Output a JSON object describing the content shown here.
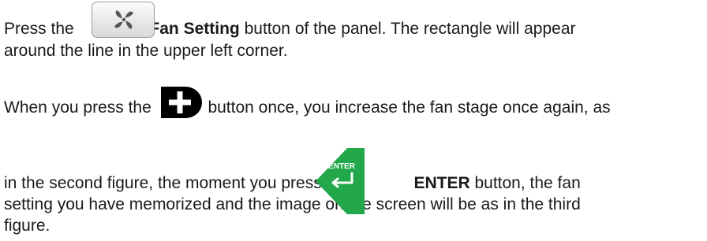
{
  "para1": {
    "pre": "Press the",
    "bold": "Fan Setting",
    "post": "button of the panel. The rectangle will appear",
    "line2": "around the line in the upper left corner."
  },
  "para2": {
    "pre": "When you press the",
    "post": "button once, you increase the fan stage once again, as"
  },
  "para3": {
    "pre": "in the second figure, the moment you press the",
    "bold": "ENTER",
    "post": "button, the fan",
    "line2": "setting you have memorized and the image on the screen will be as in the third",
    "line3": "figure."
  },
  "icons": {
    "fan_button": "fan-icon",
    "plus_button": "plus-icon",
    "enter_button": "enter-arrow-icon",
    "enter_text": "ENTER",
    "enter_color": "#22a84a",
    "plus_color": "#000000"
  }
}
